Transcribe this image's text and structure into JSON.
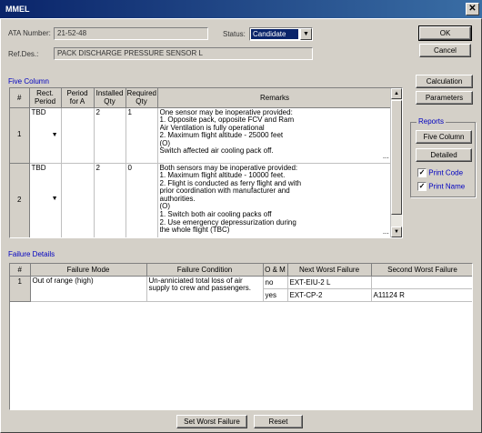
{
  "window": {
    "title": "MMEL",
    "close_label": "✕"
  },
  "header": {
    "ata_label": "ATA Number:",
    "ata_value": "21-52-48",
    "status_label": "Status:",
    "status_value": "Candidate",
    "refdes_label": "Ref.Des.:",
    "refdes_value": "PACK DISCHARGE PRESSURE SENSOR L"
  },
  "buttons": {
    "ok": "OK",
    "cancel": "Cancel",
    "calculation": "Calculation",
    "parameters": "Parameters",
    "five_column": "Five Column",
    "detailed": "Detailed",
    "set_worst_failure": "Set Worst Failure",
    "reset": "Reset"
  },
  "reports": {
    "title": "Reports",
    "print_code_label": "Print Code",
    "print_code_checked": true,
    "print_name_label": "Print Name",
    "print_name_checked": true
  },
  "five_column": {
    "title": "Five Column",
    "columns": [
      "#",
      "Rect. Period",
      "Period for A",
      "Installed Qty",
      "Required Qty",
      "Remarks"
    ],
    "rows": [
      {
        "num": "1",
        "rect_period": "TBD",
        "period_for_a": "",
        "installed_qty": "2",
        "required_qty": "1",
        "remarks": "One sensor may be inoperative provided:\n1. Opposite pack, opposite FCV and Ram\nAir Ventilation is fully operational\n2. Maximum flight altitude - 25000 feet\n(O)\nSwitch affected air cooling pack off."
      },
      {
        "num": "2",
        "rect_period": "TBD",
        "period_for_a": "",
        "installed_qty": "2",
        "required_qty": "0",
        "remarks": "Both sensors may be inoperative provided:\n1. Maximum flight altitude - 10000 feet.\n2. Flight is conducted as ferry flight and with\nprior coordination with manufacturer and\nauthorities.\n(O)\n1. Switch both air cooling packs off\n2. Use emergency depressurization during\nthe whole flight (TBC)"
      }
    ]
  },
  "failure_details": {
    "title": "Failure Details",
    "columns": [
      "#",
      "Failure Mode",
      "Failure Condition",
      "O & M",
      "Next Worst Failure",
      "Second Worst Failure"
    ],
    "rows": [
      {
        "num": "1",
        "failure_mode": "Out of range (high)",
        "failure_condition": "Un-anniciated total loss of air supply to crew and passengers.",
        "sub": [
          {
            "om": "no",
            "next_worst": "EXT-EIU-2 L",
            "second_worst": ""
          },
          {
            "om": "yes",
            "next_worst": "EXT-CP-2",
            "second_worst": "A11124 R"
          }
        ]
      }
    ]
  }
}
